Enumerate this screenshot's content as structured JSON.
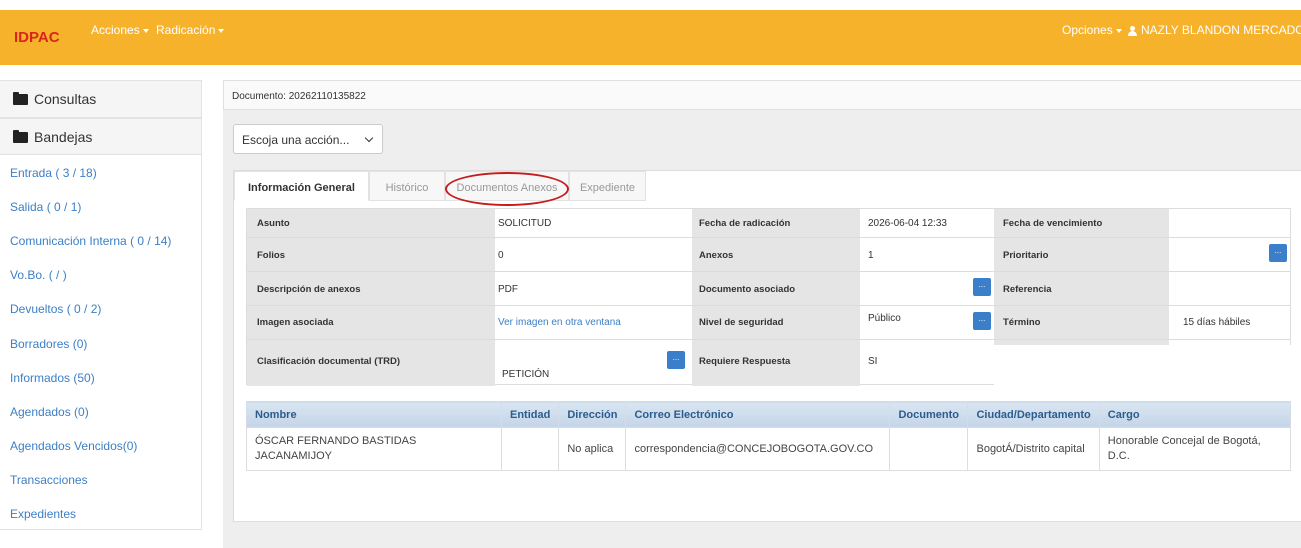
{
  "header": {
    "brand": "IDPAC",
    "menu_acciones": "Acciones",
    "menu_radicacion": "Radicación",
    "menu_opciones": "Opciones",
    "user_name": "NAZLY BLANDON MERCADO",
    "bar_color": "#f7b22c",
    "brand_color": "#d9261c"
  },
  "sidebar": {
    "consultas": "Consultas",
    "bandejas": "Bandejas",
    "links": [
      "Entrada ( 3 / 18)",
      "Salida ( 0 / 1)",
      "Comunicación Interna ( 0 / 14)",
      "Vo.Bo. ( / )",
      "Devueltos ( 0 / 2)",
      "Borradores (0)",
      "Informados (50)",
      "Agendados (0)",
      "Agendados Vencidos(0)",
      "Transacciones",
      "Expedientes"
    ]
  },
  "main": {
    "document_label": "Documento: 20262110135822",
    "action_select": "Escoja una acción...",
    "tabs": [
      "Información General",
      "Histórico",
      "Documentos Anexos",
      "Expediente"
    ],
    "active_tab": "Información General",
    "highlighted_tab": "Documentos Anexos",
    "info": {
      "asunto_label": "Asunto",
      "asunto": "SOLICITUD",
      "fecha_radicacion_label": "Fecha de radicación",
      "fecha_radicacion": "2026-06-04 12:33",
      "fecha_vencimiento_label": "Fecha de vencimiento",
      "fecha_vencimiento": "",
      "folios_label": "Folios",
      "folios": "0",
      "anexos_label": "Anexos",
      "anexos": "1",
      "prioritario_label": "Prioritario",
      "descripcion_label": "Descripción de anexos",
      "descripcion": "PDF",
      "documento_asociado_label": "Documento asociado",
      "referencia_label": "Referencia",
      "imagen_label": "Imagen asociada",
      "imagen_link": "Ver imagen en otra ventana",
      "nivel_label": "Nivel de seguridad",
      "nivel": "Público",
      "termino_label": "Término",
      "termino": "15 días hábiles",
      "clasificacion_label": "Clasificación documental (TRD)",
      "clasificacion": "PETICIÓN",
      "requiere_label": "Requiere Respuesta",
      "requiere": "SI",
      "dots": "..."
    },
    "people_table": {
      "headers": [
        "Nombre",
        "Entidad",
        "Dirección",
        "Correo Electrónico",
        "Documento",
        "Ciudad/Departamento",
        "Cargo"
      ],
      "rows": [
        {
          "nombre": "ÓSCAR FERNANDO BASTIDAS JACANAMIJOY",
          "entidad": "",
          "direccion": "No aplica",
          "correo": "correspondencia@CONCEJOBOGOTA.GOV.CO",
          "documento": "",
          "ciudad": "BogotÁ/Distrito capital",
          "cargo": "Honorable Concejal de Bogotá, D.C."
        }
      ]
    }
  }
}
